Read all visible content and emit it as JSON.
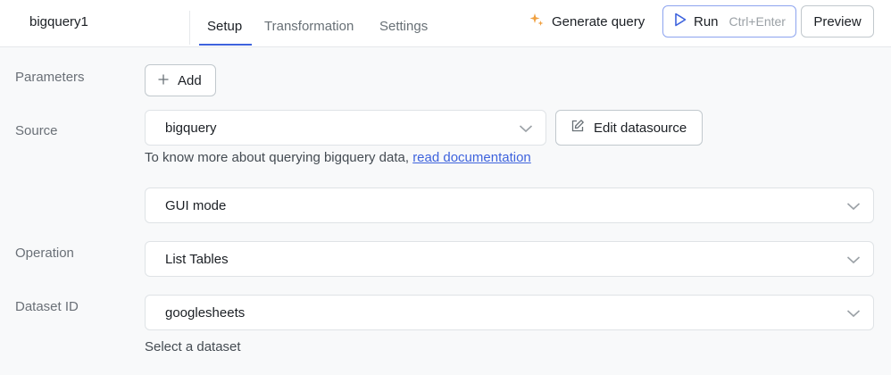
{
  "header": {
    "query_name": "bigquery1",
    "tabs": [
      {
        "label": "Setup",
        "active": true
      },
      {
        "label": "Transformation",
        "active": false
      },
      {
        "label": "Settings",
        "active": false
      }
    ],
    "generate_label": "Generate query",
    "run_label": "Run",
    "run_shortcut": "Ctrl+Enter",
    "preview_label": "Preview"
  },
  "form": {
    "parameters_label": "Parameters",
    "add_label": "Add",
    "source_label": "Source",
    "source_value": "bigquery",
    "edit_datasource_label": "Edit datasource",
    "source_hint": "To know more about querying bigquery data,",
    "source_hint_link": "read documentation",
    "mode_value": "GUI mode",
    "operation_label": "Operation",
    "operation_value": "List Tables",
    "dataset_label": "Dataset ID",
    "dataset_value": "googlesheets",
    "dataset_hint": "Select a dataset"
  },
  "colors": {
    "accent": "#3e63dd",
    "sparkle": "#f0a040",
    "label_gray": "#6a7077"
  }
}
